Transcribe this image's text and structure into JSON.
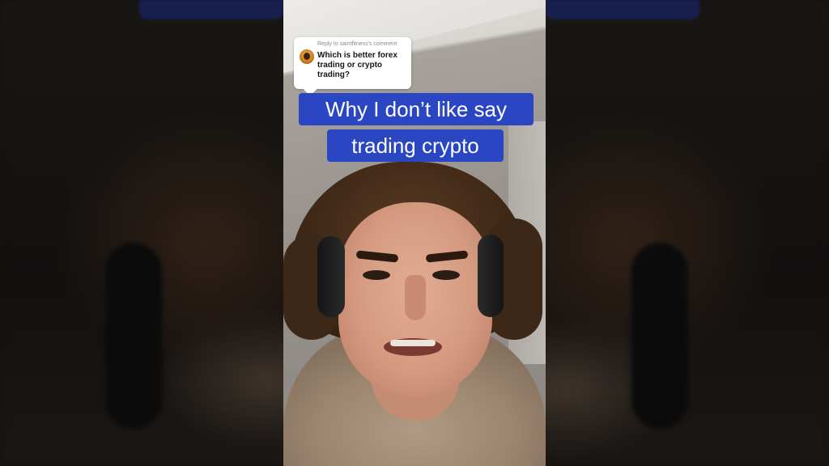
{
  "reply_card": {
    "header": "Reply to saintfitness's comment",
    "comment": "Which is better forex trading or crypto trading?"
  },
  "captions": {
    "line1": "Why I don’t like say",
    "line2": "trading crypto"
  },
  "colors": {
    "caption_background": "#2a46c2",
    "caption_text": "#ffffff",
    "reply_card_background": "#ffffff",
    "letterbox_background": "#1f1b18"
  },
  "icons": {
    "reply_avatar": "user-avatar-icon"
  }
}
